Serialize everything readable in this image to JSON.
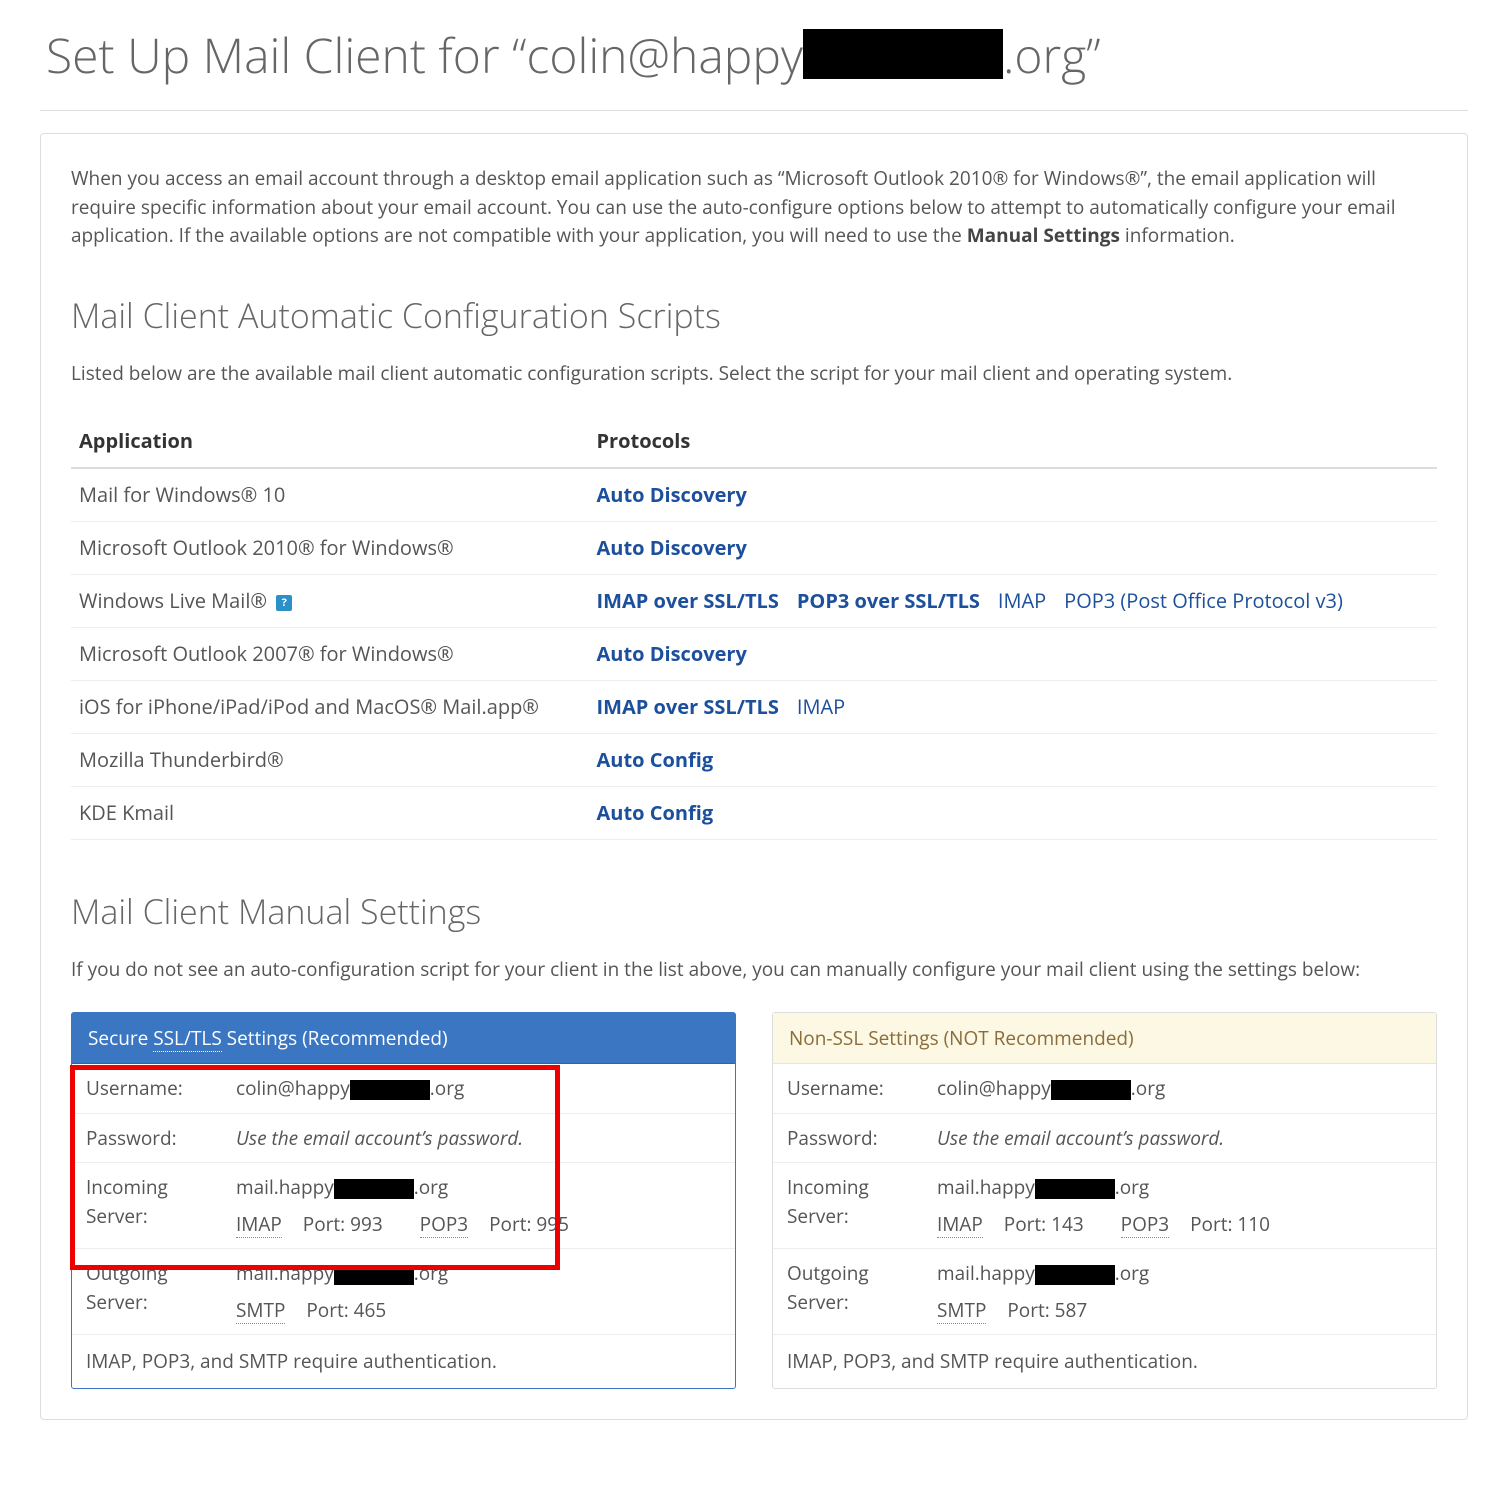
{
  "page": {
    "title_prefix": "Set Up Mail Client for “colin@happy",
    "title_suffix": ".org”"
  },
  "intro": {
    "text_before": "When you access an email account through a desktop email application such as “Microsoft Outlook 2010® for Windows®”, the email application will require specific information about your email account. You can use the auto-configure options below to attempt to automatically configure your email application. If the available options are not compatible with your application, you will need to use the ",
    "bold": "Manual Settings",
    "text_after": " information."
  },
  "auto_section": {
    "heading": "Mail Client Automatic Configuration Scripts",
    "desc": "Listed below are the available mail client automatic configuration scripts. Select the script for your mail client and operating system."
  },
  "table": {
    "headers": {
      "app": "Application",
      "proto": "Protocols"
    },
    "rows": [
      {
        "app": "Mail for Windows® 10",
        "links": [
          {
            "t": "Auto Discovery",
            "b": true
          }
        ]
      },
      {
        "app": "Microsoft Outlook 2010® for Windows®",
        "links": [
          {
            "t": "Auto Discovery",
            "b": true
          }
        ]
      },
      {
        "app": "Windows Live Mail®",
        "help": true,
        "links": [
          {
            "t": "IMAP over SSL/TLS",
            "b": true
          },
          {
            "t": "POP3 over SSL/TLS",
            "b": true
          },
          {
            "t": "IMAP",
            "b": false
          },
          {
            "t": "POP3 (Post Office Protocol v3)",
            "b": false
          }
        ]
      },
      {
        "app": "Microsoft Outlook 2007® for Windows®",
        "links": [
          {
            "t": "Auto Discovery",
            "b": true
          }
        ]
      },
      {
        "app": "iOS for iPhone/iPad/iPod and MacOS® Mail.app®",
        "links": [
          {
            "t": "IMAP over SSL/TLS",
            "b": true
          },
          {
            "t": "IMAP",
            "b": false
          }
        ]
      },
      {
        "app": "Mozilla Thunderbird®",
        "links": [
          {
            "t": "Auto Config",
            "b": true
          }
        ]
      },
      {
        "app": "KDE Kmail",
        "links": [
          {
            "t": "Auto Config",
            "b": true
          }
        ]
      }
    ]
  },
  "manual_section": {
    "heading": "Mail Client Manual Settings",
    "desc": "If you do not see an auto-configuration script for your client in the list above, you can manually configure your mail client using the settings below:"
  },
  "ssl": {
    "header_pre": "Secure ",
    "header_abbr": "SSL/TLS",
    "header_post": " Settings (Recommended)",
    "username_label": "Username:",
    "username_pre": "colin@happy",
    "username_post": ".org",
    "password_label": "Password:",
    "password_val": "Use the email account’s password.",
    "incoming_label": "Incoming Server:",
    "server_pre": "mail.happy",
    "server_post": ".org",
    "imap_label": "IMAP",
    "imap_port": " Port: 993",
    "pop3_label": "POP3",
    "pop3_port": " Port: 995",
    "outgoing_label": "Outgoing Server:",
    "smtp_label": "SMTP",
    "smtp_port": " Port: 465",
    "footer": "IMAP, POP3, and SMTP require authentication."
  },
  "nonssl": {
    "header": "Non-SSL Settings (NOT Recommended)",
    "username_label": "Username:",
    "username_pre": "colin@happy",
    "username_post": ".org",
    "password_label": "Password:",
    "password_val": "Use the email account’s password.",
    "incoming_label": "Incoming Server:",
    "server_pre": "mail.happy",
    "server_post": ".org",
    "imap_label": "IMAP",
    "imap_port": " Port: 143",
    "pop3_label": "POP3",
    "pop3_port": " Port: 110",
    "outgoing_label": "Outgoing Server:",
    "smtp_label": "SMTP",
    "smtp_port": " Port: 587",
    "footer": "IMAP, POP3, and SMTP require authentication."
  }
}
